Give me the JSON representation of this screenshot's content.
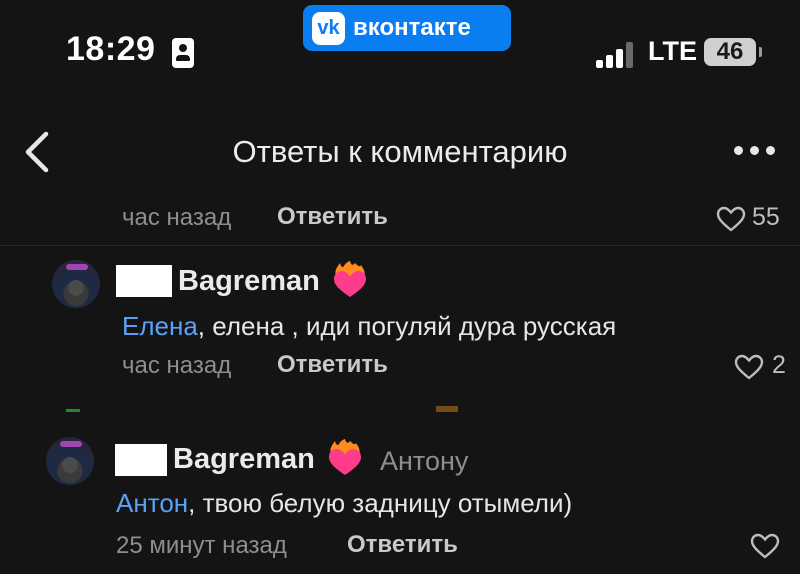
{
  "status_bar": {
    "time": "18:29",
    "network": "LTE",
    "battery": "46"
  },
  "app_badge": {
    "logo": "vk",
    "name": "вконтакте"
  },
  "header": {
    "title": "Ответы к комментарию"
  },
  "icons": [
    "id-card-icon",
    "vk-logo-icon",
    "signal-icon",
    "battery-icon",
    "back-chevron-icon",
    "more-dots-icon",
    "heart-icon",
    "flame-heart-icon"
  ],
  "colors": {
    "background": "#141414",
    "mention": "#5aa2f5",
    "vk_blue": "#0a7df0",
    "flame_heart": "#ff3c8c"
  },
  "comments": [
    {
      "time": "час назад",
      "reply": "Ответить",
      "likes": "55"
    },
    {
      "author": "Bagreman",
      "mention": "Елена",
      "text": ", елена , иди погуляй дура русская",
      "time": "час назад",
      "reply": "Ответить",
      "likes": "2"
    },
    {
      "author": "Bagreman",
      "addressee": "Антону",
      "mention": "Антон",
      "text": ", твою белую задницу отымели)",
      "time": "25 минут назад",
      "reply": "Ответить",
      "likes": ""
    }
  ]
}
